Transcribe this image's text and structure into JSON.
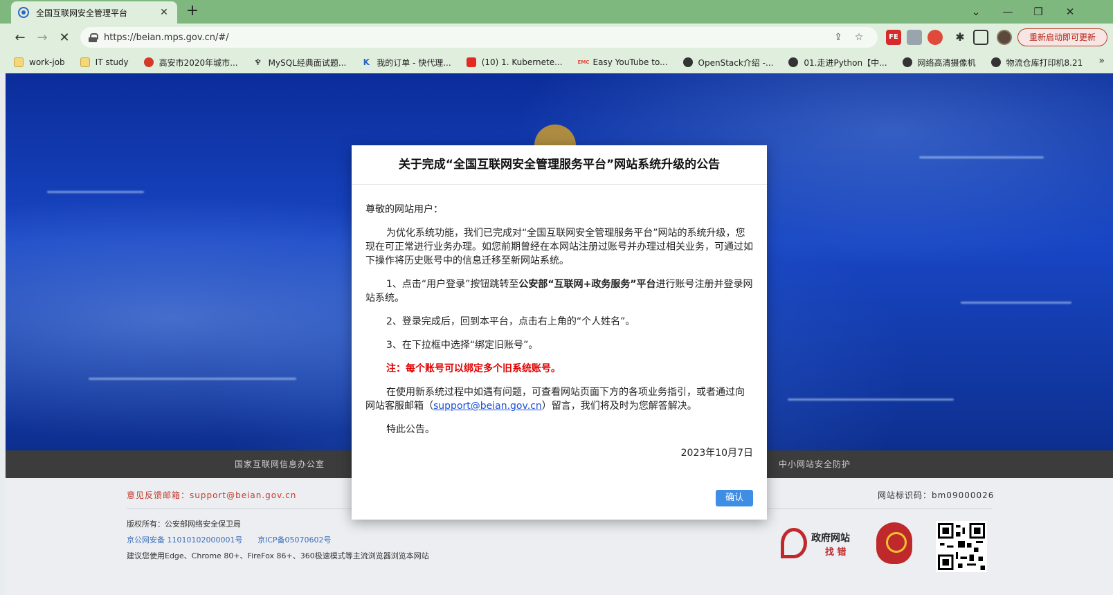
{
  "browser": {
    "tab_title": "全国互联网安全管理平台",
    "tab_close": "✕",
    "new_tab": "+",
    "url": "https://beian.mps.gov.cn/#/",
    "update_button": "重新启动即可更新",
    "extensions": [
      "FE",
      "",
      "",
      ""
    ],
    "bookmarks": [
      {
        "label": "work-job",
        "icon": "folder-icon"
      },
      {
        "label": "IT study",
        "icon": "folder-icon"
      },
      {
        "label": "高安市2020年城市...",
        "icon": "emblem-icon"
      },
      {
        "label": "MySQL经典面试题...",
        "icon": "wing-icon"
      },
      {
        "label": "我的订单 - 快代理...",
        "icon": "k-icon"
      },
      {
        "label": "(10) 1. Kubernete...",
        "icon": "youtube-icon"
      },
      {
        "label": "Easy YouTube to...",
        "icon": "emc-icon"
      },
      {
        "label": "OpenStack介绍 -...",
        "icon": "globe-icon"
      },
      {
        "label": "01.走进Python【中...",
        "icon": "globe-icon"
      },
      {
        "label": "网络高清摄像机",
        "icon": "globe-icon"
      },
      {
        "label": "物流仓库打印机8.21",
        "icon": "globe-icon"
      }
    ],
    "bookmarks_more": "»"
  },
  "footer": {
    "nav_left": "国家互联网信息办公室",
    "nav_right": "中小网站安全防护",
    "feedback": "意见反馈邮箱：support@beian.gov.cn",
    "site_id": "网站标识码：bm09000026",
    "copyright": "版权所有：公安部网络安全保卫局",
    "beian_police": "京公网安备 11010102000001号",
    "beian_icp": "京ICP备05070602号",
    "browser_tip": "建议您使用Edge、Chrome 80+、FireFox 86+、360极速模式等主流浏览器浏览本网站",
    "gov_find_line1": "政府网站",
    "gov_find_line2": "找 错"
  },
  "modal": {
    "title": "关于完成“全国互联网安全管理服务平台”网站系统升级的公告",
    "greeting": "尊敬的网站用户：",
    "intro": "为优化系统功能，我们已完成对“全国互联网安全管理服务平台”网站的系统升级，您现在可正常进行业务办理。如您前期曾经在本网站注册过账号并办理过相关业务，可通过如下操作将历史账号中的信息迁移至新网站系统。",
    "step1_a": "1、点击“用户登录”按钮跳转至",
    "step1_bold": "公安部“互联网+政务服务”平台",
    "step1_b": "进行账号注册并登录网站系统。",
    "step2": "2、登录完成后，回到本平台，点击右上角的“个人姓名”。",
    "step3": "3、在下拉框中选择“绑定旧账号”。",
    "note": "注：每个账号可以绑定多个旧系统账号。",
    "help_a": "在使用新系统过程中如遇有问题，可查看网站页面下方的各项业务指引，或者通过向网站客服邮箱（",
    "help_mail": "support@beian.gov.cn",
    "help_b": "）留言，我们将及时为您解答解决。",
    "closing": "特此公告。",
    "date": "2023年10月7日",
    "confirm": "确认"
  }
}
